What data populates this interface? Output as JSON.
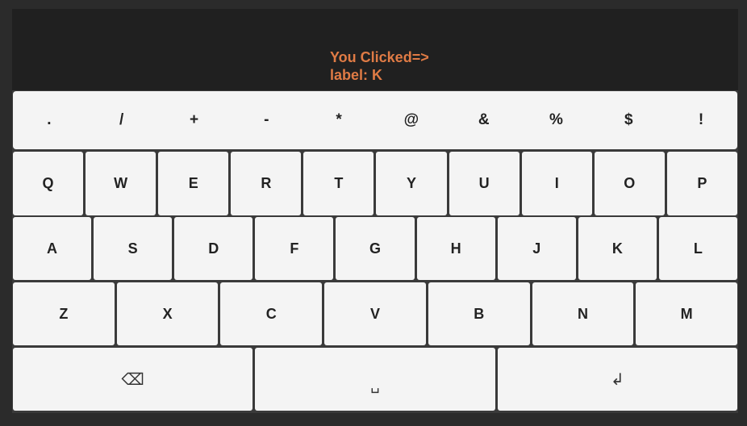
{
  "status": {
    "line1": "You Clicked=>",
    "line2": "label: K"
  },
  "keyboard": {
    "symbols": [
      ".",
      "/",
      "+",
      "-",
      "*",
      "@",
      "&",
      "%",
      "$",
      "!"
    ],
    "row_q": [
      "Q",
      "W",
      "E",
      "R",
      "T",
      "Y",
      "U",
      "I",
      "O",
      "P"
    ],
    "row_a": [
      "A",
      "S",
      "D",
      "F",
      "G",
      "H",
      "J",
      "K",
      "L"
    ],
    "row_z": [
      "Z",
      "X",
      "C",
      "V",
      "B",
      "N",
      "M"
    ],
    "bottom": {
      "backspace_glyph": "⌫",
      "space_glyph": "␣",
      "enter_glyph": "↲"
    }
  },
  "icons": {
    "backspace": "backspace-icon",
    "space": "space-icon",
    "enter": "enter-icon"
  },
  "colors": {
    "accent": "#e07b45",
    "panel": "#202020",
    "key": "#f4f4f4",
    "key_text": "#222222"
  }
}
